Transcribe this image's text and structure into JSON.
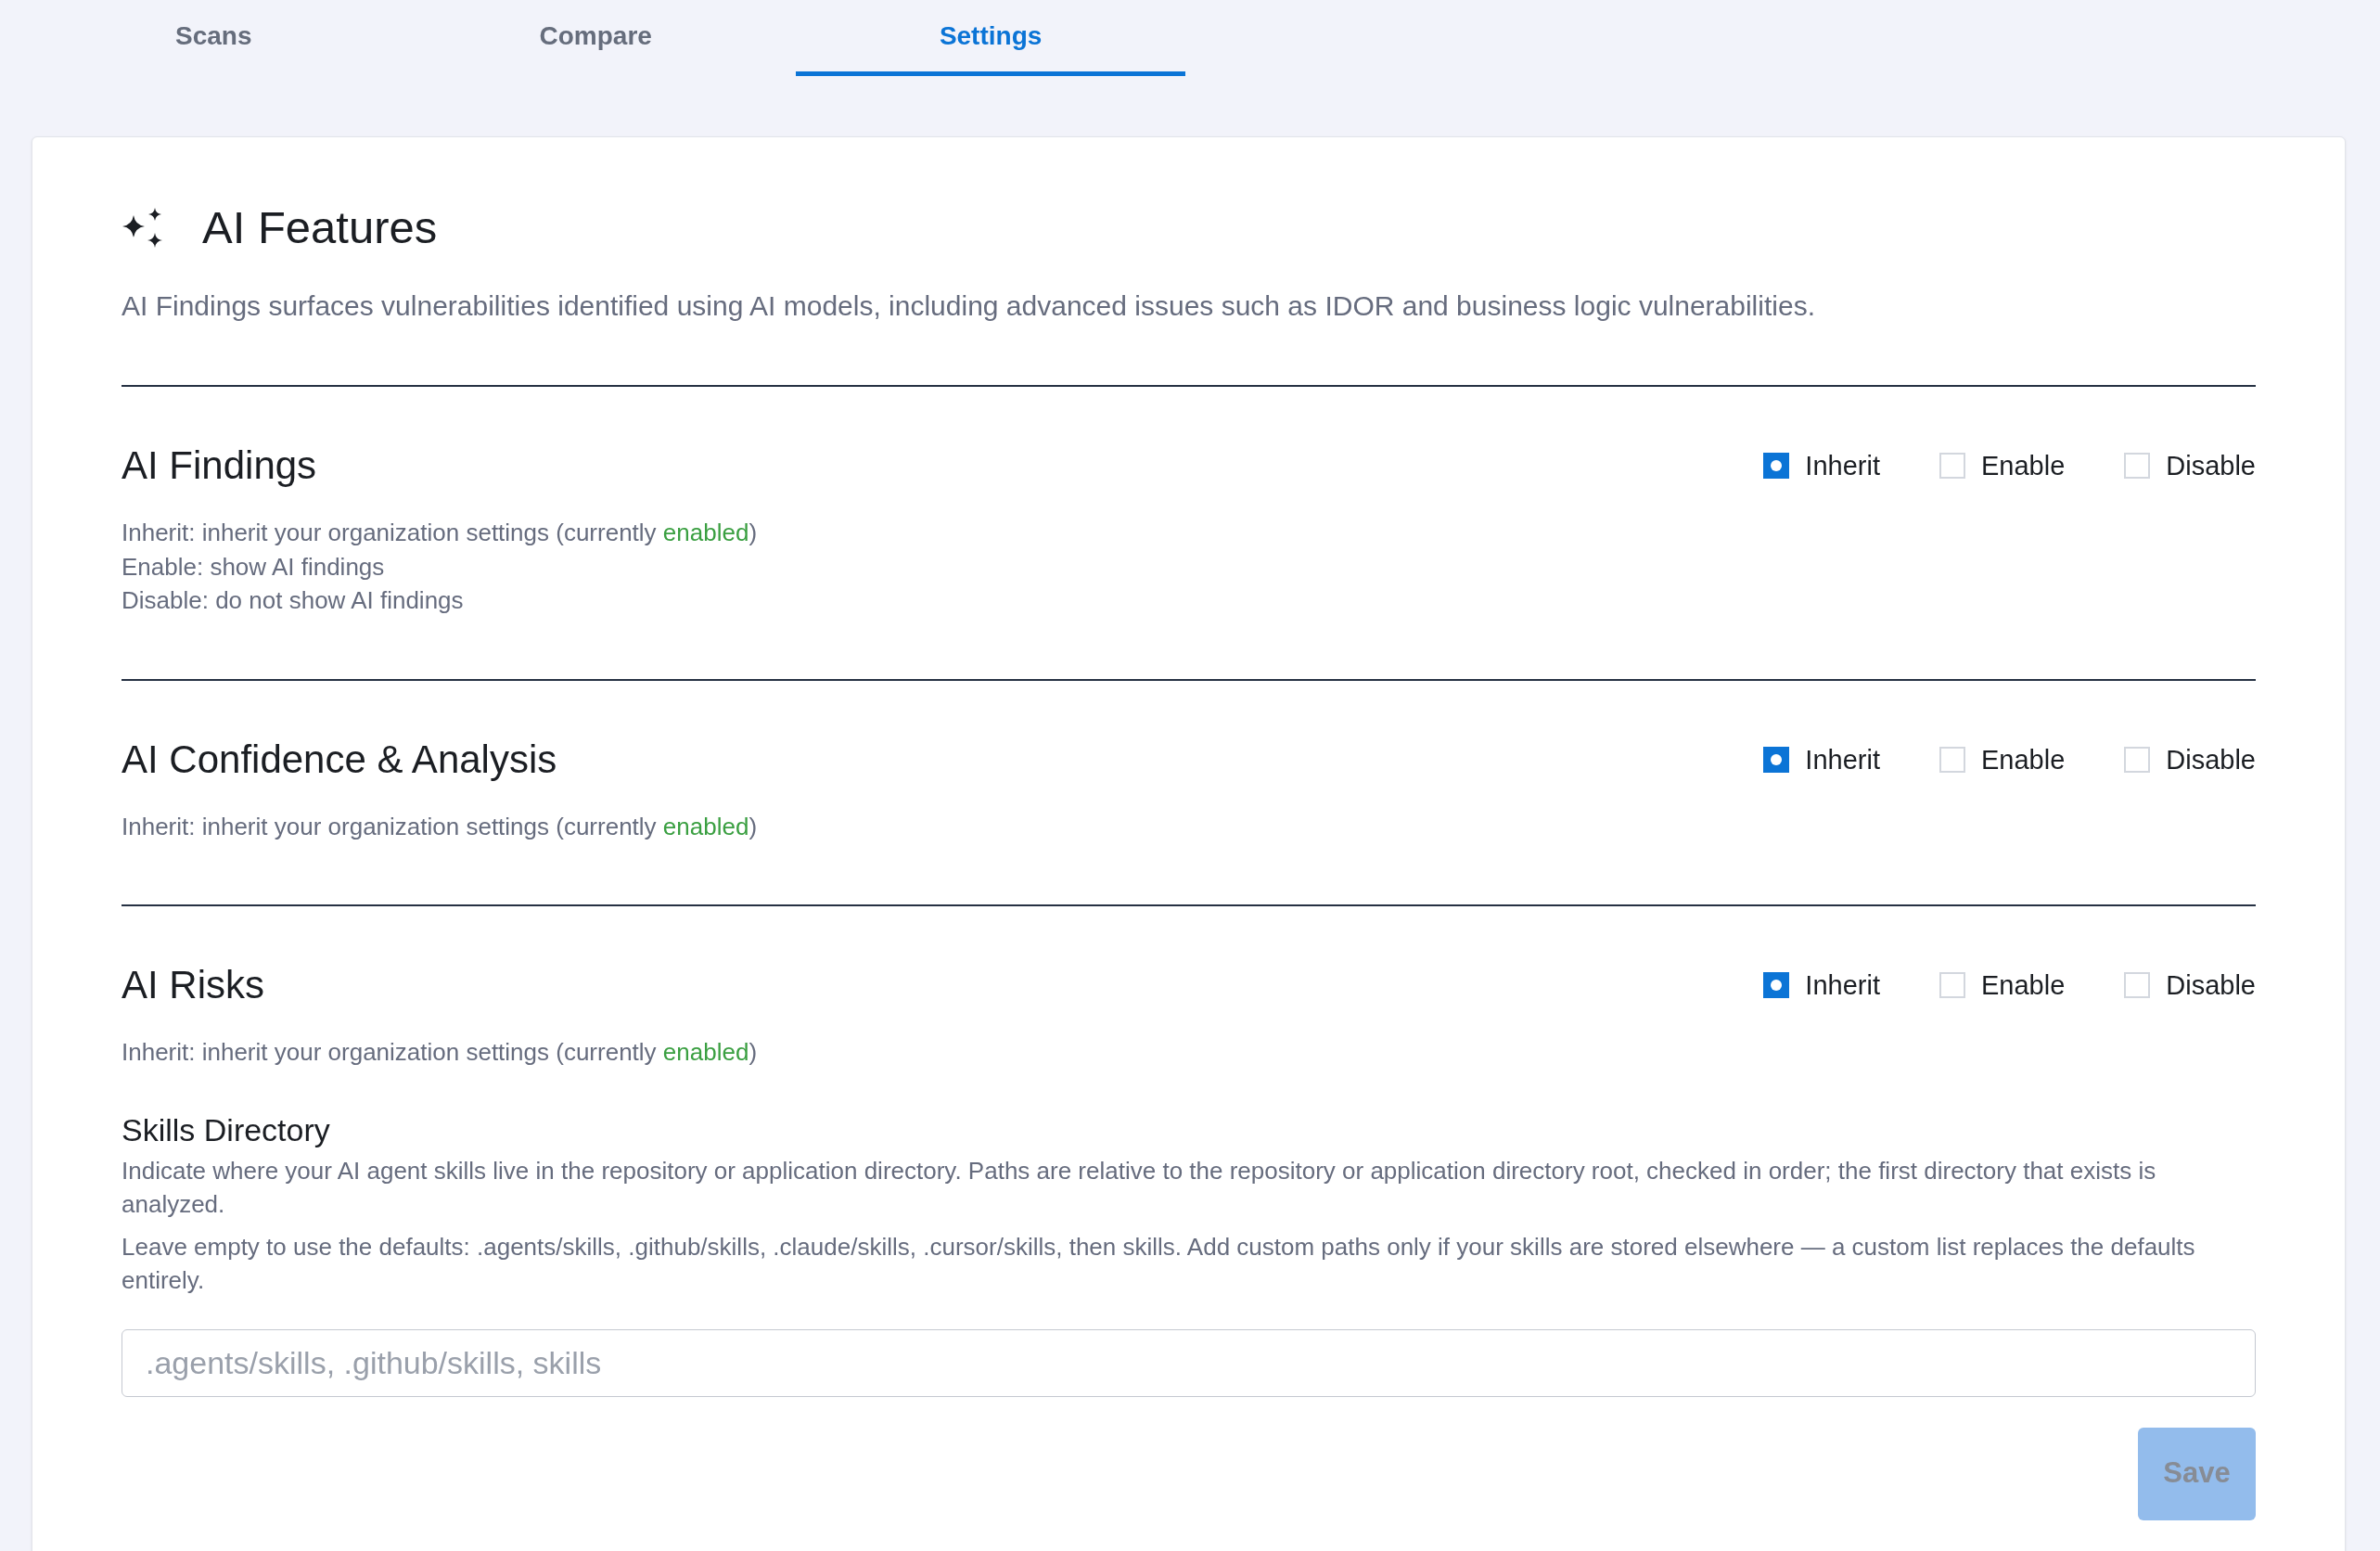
{
  "tabs": [
    {
      "label": "Scans",
      "selected": false
    },
    {
      "label": "Compare",
      "selected": false
    },
    {
      "label": "Settings",
      "selected": true
    }
  ],
  "panel": {
    "title": "AI Features",
    "description": "AI Findings surfaces vulnerabilities identified using AI models, including advanced issues such as IDOR and business logic vulnerabilities.",
    "settings": [
      {
        "title": "AI Findings",
        "options": [
          {
            "label": "Inherit",
            "selected": true
          },
          {
            "label": "Enable",
            "selected": false
          },
          {
            "label": "Disable",
            "selected": false
          }
        ],
        "help": [
          {
            "kind": "inherit",
            "text": "Inherit: inherit your organization settings (currently ",
            "status": "enabled",
            "status_on": true,
            "suffix": ")"
          },
          {
            "kind": "plain",
            "text": "Enable: show AI findings"
          },
          {
            "kind": "plain",
            "text": "Disable: do not show AI findings"
          }
        ]
      },
      {
        "title": "AI Confidence & Analysis",
        "options": [
          {
            "label": "Inherit",
            "selected": true
          },
          {
            "label": "Enable",
            "selected": false
          },
          {
            "label": "Disable",
            "selected": false
          }
        ],
        "help": [
          {
            "kind": "inherit",
            "text": "Inherit: inherit your organization settings (currently ",
            "status": "enabled",
            "status_on": true,
            "suffix": ")"
          }
        ]
      },
      {
        "title": "AI Risks",
        "options": [
          {
            "label": "Inherit",
            "selected": true
          },
          {
            "label": "Enable",
            "selected": false
          },
          {
            "label": "Disable",
            "selected": false
          }
        ],
        "help": [
          {
            "kind": "inherit",
            "text": "Inherit: inherit your organization settings (currently ",
            "status": "enabled",
            "status_on": true,
            "suffix": ")"
          }
        ]
      }
    ],
    "skills_directory": {
      "title": "Skills Directory",
      "paragraphs": [
        "Indicate where your AI agent skills live in the repository or application directory. Paths are relative to the repository or application directory root, checked in order; the first directory that exists is analyzed.",
        "Leave empty to use the defaults: .agents/skills, .github/skills, .claude/skills, .cursor/skills, then skills. Add custom paths only if your skills are stored elsewhere — a custom list replaces the defaults entirely."
      ],
      "input": {
        "placeholder": ".agents/skills, .github/skills, skills"
      },
      "save_button": {
        "label": "Save",
        "disabled": true
      }
    }
  }
}
